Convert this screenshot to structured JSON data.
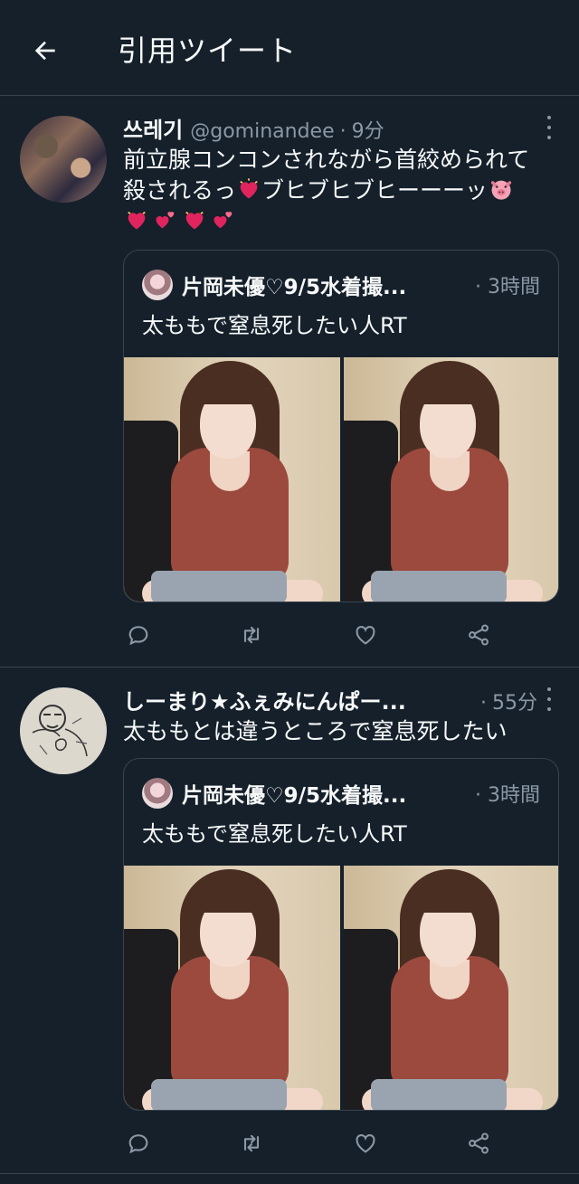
{
  "header": {
    "title": "引用ツイート",
    "back_icon": "arrow-left-icon"
  },
  "tweets": [
    {
      "name": "쓰레기",
      "handle": "@gominandee",
      "sep": "·",
      "time": "9分",
      "text_line1": "前立腺コンコンされながら首絞められて",
      "text_line2a": "殺されるっ",
      "text_line2b": "ブヒブヒブヒーーーッ",
      "emoji_line": "💘💞💘💞",
      "quote": {
        "name": "片岡未優♡9/5水着撮...",
        "sep": "·",
        "time": "3時間",
        "text": "太ももで窒息死したい人RT"
      }
    },
    {
      "name": "しーまり★ふぇみにんぱー...",
      "sep": "·",
      "time": "55分",
      "text": "太ももとは違うところで窒息死したい",
      "quote": {
        "name": "片岡未優♡9/5水着撮...",
        "sep": "·",
        "time": "3時間",
        "text": "太ももで窒息死したい人RT"
      }
    }
  ],
  "icons": {
    "reply": "reply-icon",
    "retweet": "retweet-icon",
    "like": "heart-icon",
    "share": "share-icon",
    "more": "more-icon"
  },
  "colors": {
    "background": "#15202b",
    "text": "#f7f9f9",
    "secondary": "#8b98a5",
    "border": "#38444d"
  }
}
